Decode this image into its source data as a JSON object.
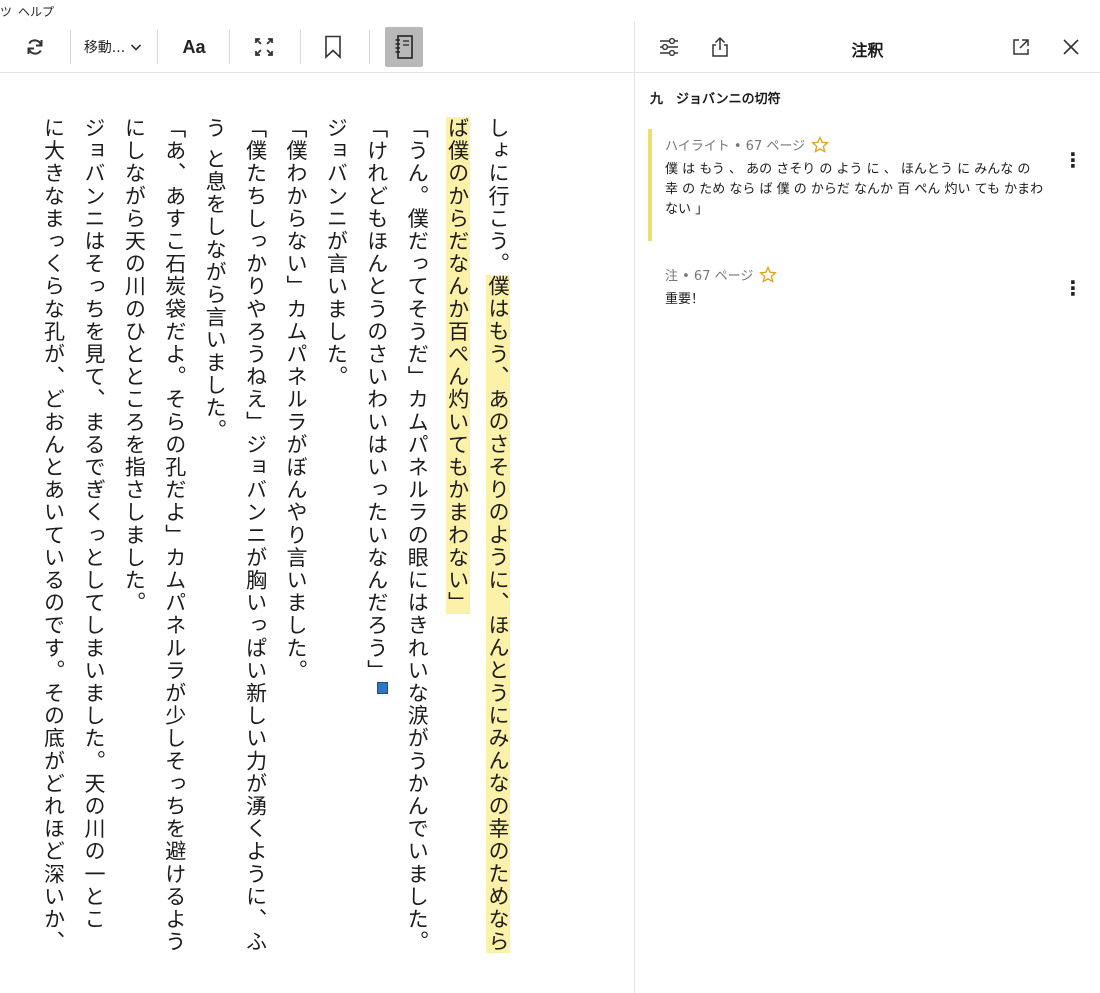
{
  "menubar": {
    "items": [
      "ツ",
      "ヘルプ"
    ]
  },
  "toolbar": {
    "move_label": "移動...",
    "font_label": "Aa"
  },
  "panel": {
    "title": "注釈",
    "chapter": "九　ジョバンニの切符",
    "entries": [
      {
        "meta": "ハイライト • 67 ページ",
        "text": "僕 は もう 、 あの さそり の よう に 、 ほんとう に みんな の 幸 の ため なら ば 僕 の からだ なんか 百 ぺん 灼い ても かまわ ない 」",
        "menu": "⋮"
      },
      {
        "meta": "注 • 67 ページ",
        "text": "重要！",
        "menu": "⋮"
      }
    ]
  },
  "book": {
    "hl1_plain": "しょに行こう。",
    "hl1_mark": "僕はもう、あのさそりのように、ほんとうにみんなの幸のためなら",
    "hl2_mark": "ば僕のからだなんか百ぺん灼いてもかまわない」",
    "lines": [
      "「うん。僕だってそうだ」カムパネルラの眼にはきれいな涙がうかんでいました。",
      "「けれどもほんとうのさいわいはいったいなんだろう」",
      "ジョバンニが言いました。",
      "「僕わからない」カムパネルラがぼんやり言いました。",
      "「僕たちしっかりやろうねえ」ジョバンニが胸いっぱい新しい力が湧くように、ふ",
      "う と息をしながら言いました。",
      "「あ、あすこ石炭袋だよ。そらの孔だよ」カムパネルラが少しそっちを避けるよう",
      "にしながら天の川のひとところを指さしました。",
      "ジョバンニはそっちを見て、まるでぎくっとしてしまいました。天の川の一とこ",
      "に大きなまっくらな孔が、どおんとあいているのです。その底がどれほど深いか、"
    ]
  }
}
